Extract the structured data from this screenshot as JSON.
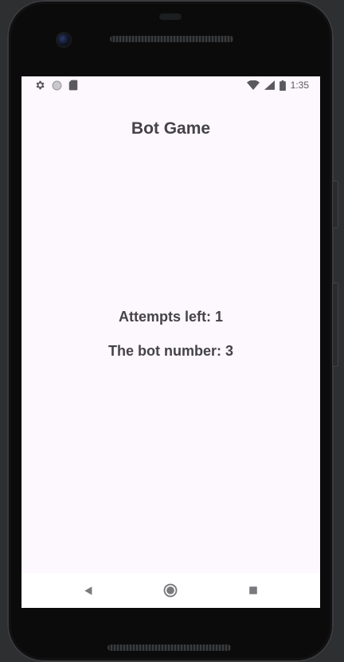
{
  "status_bar": {
    "left_icons": [
      "gear-icon",
      "circle-status-icon",
      "sd-card-icon"
    ],
    "right_icons": [
      "wifi-icon",
      "cell-signal-icon",
      "battery-icon"
    ],
    "time": "1:35"
  },
  "app": {
    "title": "Bot Game",
    "attempts_text": "Attempts left: 1",
    "bot_number_text": "The bot number: 3"
  },
  "nav_bar": {
    "buttons": [
      "back-icon",
      "home-icon",
      "recents-icon"
    ]
  },
  "colors": {
    "screen_background": "#fdf7fe",
    "text": "#444349",
    "nav_background": "#ffffff",
    "nav_icon": "#7a7a7e"
  }
}
